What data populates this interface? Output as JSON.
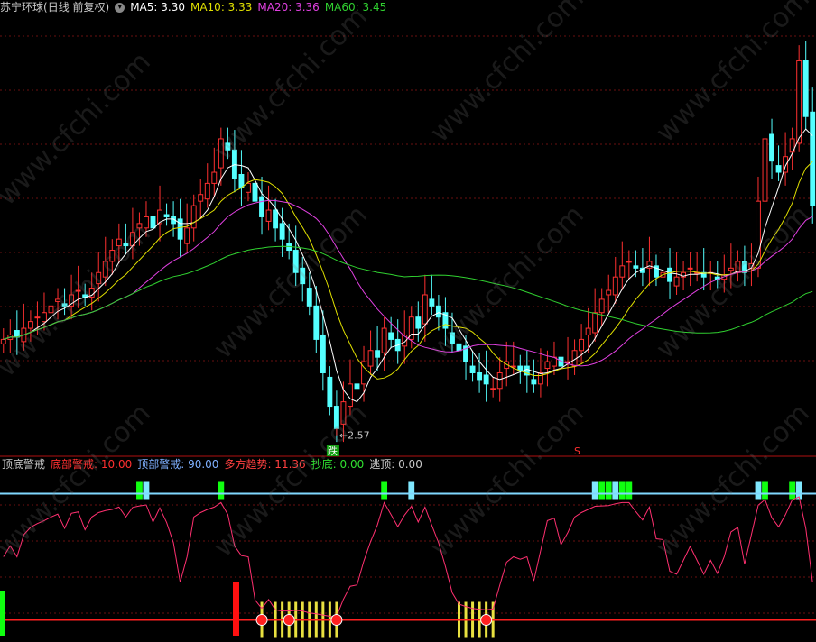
{
  "header": {
    "stock": "苏宁环球",
    "period": "(日线 前复权)",
    "ma5_label": "MA5: 3.30",
    "ma10_label": "MA10: 3.33",
    "ma20_label": "MA20: 3.36",
    "ma60_label": "MA60: 3.45",
    "colors": {
      "stock": "#c8c8c8",
      "ma5": "#ffffff",
      "ma10": "#e0e000",
      "ma20": "#e040e0",
      "ma60": "#30d030"
    }
  },
  "indicator_header": {
    "name": "顶底警戒",
    "bottom_warn": "底部警戒: 10.00",
    "top_warn": "顶部警戒: 90.00",
    "trend": "多方趋势: 11.36",
    "buy": "抄底: 0.00",
    "escape": "逃顶: 0.00",
    "colors": {
      "name": "#c8c8c8",
      "bottom_warn": "#ff3030",
      "top_warn": "#7fb0ff",
      "trend": "#ff4040",
      "buy": "#30e030",
      "escape": "#c8c8c8"
    }
  },
  "annotations": {
    "low_label": "←2.57",
    "fall_marker": "跌",
    "s_marker": "S"
  },
  "watermark": "www.cfchi.com",
  "chart_data": {
    "type": "candlestick",
    "closes": [
      3.0,
      3.02,
      3.01,
      3.05,
      3.08,
      3.1,
      3.12,
      3.15,
      3.18,
      3.15,
      3.2,
      3.22,
      3.19,
      3.23,
      3.3,
      3.35,
      3.4,
      3.45,
      3.42,
      3.48,
      3.52,
      3.55,
      3.5,
      3.58,
      3.55,
      3.52,
      3.45,
      3.5,
      3.6,
      3.65,
      3.7,
      3.75,
      3.9,
      3.85,
      3.72,
      3.68,
      3.7,
      3.62,
      3.55,
      3.58,
      3.5,
      3.45,
      3.4,
      3.3,
      3.25,
      3.15,
      3.0,
      2.85,
      2.7,
      2.6,
      2.72,
      2.8,
      2.78,
      2.9,
      2.95,
      2.92,
      3.05,
      3.0,
      2.95,
      3.02,
      3.1,
      3.05,
      3.2,
      3.15,
      3.1,
      3.05,
      2.98,
      2.95,
      2.9,
      2.85,
      2.82,
      2.8,
      2.78,
      2.85,
      2.9,
      2.88,
      2.86,
      2.84,
      2.8,
      2.85,
      2.9,
      2.92,
      2.88,
      2.9,
      2.95,
      3.0,
      3.05,
      3.12,
      3.18,
      3.22,
      3.28,
      3.33,
      3.35,
      3.32,
      3.3,
      3.35,
      3.28,
      3.3,
      3.26,
      3.28,
      3.3,
      3.32,
      3.3,
      3.28,
      3.3,
      3.27,
      3.29,
      3.32,
      3.35,
      3.3,
      3.34,
      3.62,
      3.9,
      3.8,
      3.75,
      3.82,
      3.9,
      4.25,
      4.0,
      3.6
    ],
    "ma5_last": 3.3,
    "ma10_last": 3.33,
    "ma20_last": 3.36,
    "ma60_last": 3.45,
    "low_value": 2.57,
    "indicator": {
      "bottom_level": 10,
      "top_level": 90,
      "ylim": [
        0,
        100
      ]
    }
  }
}
